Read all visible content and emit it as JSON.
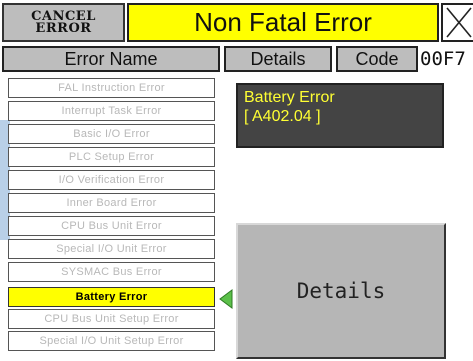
{
  "header": {
    "cancel_label": "CANCEL\nERROR",
    "title": "Non Fatal Error",
    "close_icon": "close-x-icon"
  },
  "columns": {
    "name": "Error Name",
    "details": "Details",
    "code": "Code",
    "code_value": "00F7"
  },
  "errors": [
    "FAL Instruction Error",
    "Interrupt Task Error",
    "Basic I/O Error",
    "PLC Setup Error",
    "I/O Verification Error",
    "Inner Board Error",
    "CPU Bus Unit Error",
    "Special I/O Unit Error",
    "SYSMAC Bus Error",
    "Battery Error",
    "CPU Bus Unit Setup Error",
    "Special I/O Unit Setup Error"
  ],
  "selected_error": "Battery Error",
  "detail": {
    "line1": "Battery Error",
    "line2": "[ A402.04 ]"
  },
  "details_button_label": "Details",
  "colors": {
    "highlight": "#ffff00",
    "panel": "#bdbdbd",
    "detail_bg": "#444444",
    "detail_text": "#ffff33",
    "pointer": "#5cc04a"
  }
}
